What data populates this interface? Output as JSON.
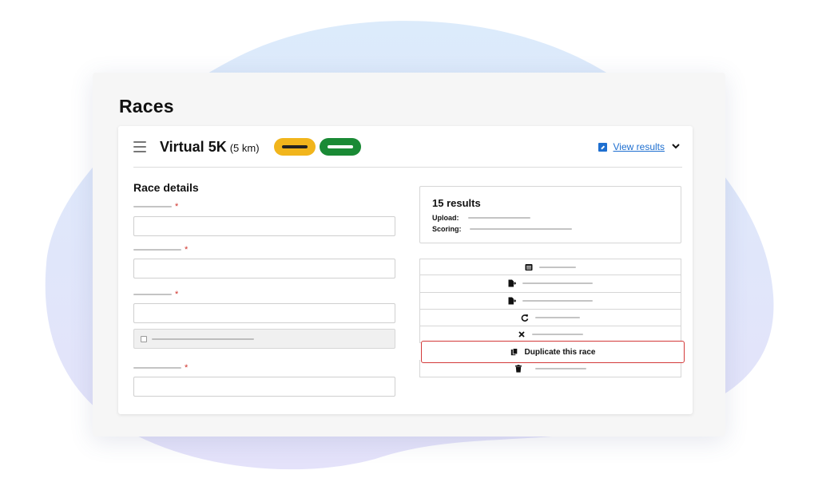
{
  "page": {
    "title": "Races"
  },
  "race": {
    "name": "Virtual 5K",
    "distance": "(5 km)",
    "view_results_label": "View results"
  },
  "colors": {
    "status_yellow": "#f1b51c",
    "status_green": "#1a8a35",
    "link_blue": "#1e6fd0",
    "required_red": "#d0342c",
    "highlight_red": "#d33a3a"
  },
  "details": {
    "title": "Race details",
    "required_mark": "*"
  },
  "results": {
    "count_label": "15 results",
    "upload_label": "Upload:",
    "scoring_label": "Scoring:"
  },
  "actions": {
    "duplicate_label": "Duplicate this race"
  },
  "icons": {
    "menu": "hamburger-icon",
    "external_link": "external-link-icon",
    "chevron": "chevron-down-icon",
    "list": "list-icon",
    "export1": "export-file-icon",
    "export2": "export-file-icon",
    "refresh": "refresh-icon",
    "close": "close-icon",
    "copy": "copy-icon",
    "trash": "trash-icon"
  }
}
